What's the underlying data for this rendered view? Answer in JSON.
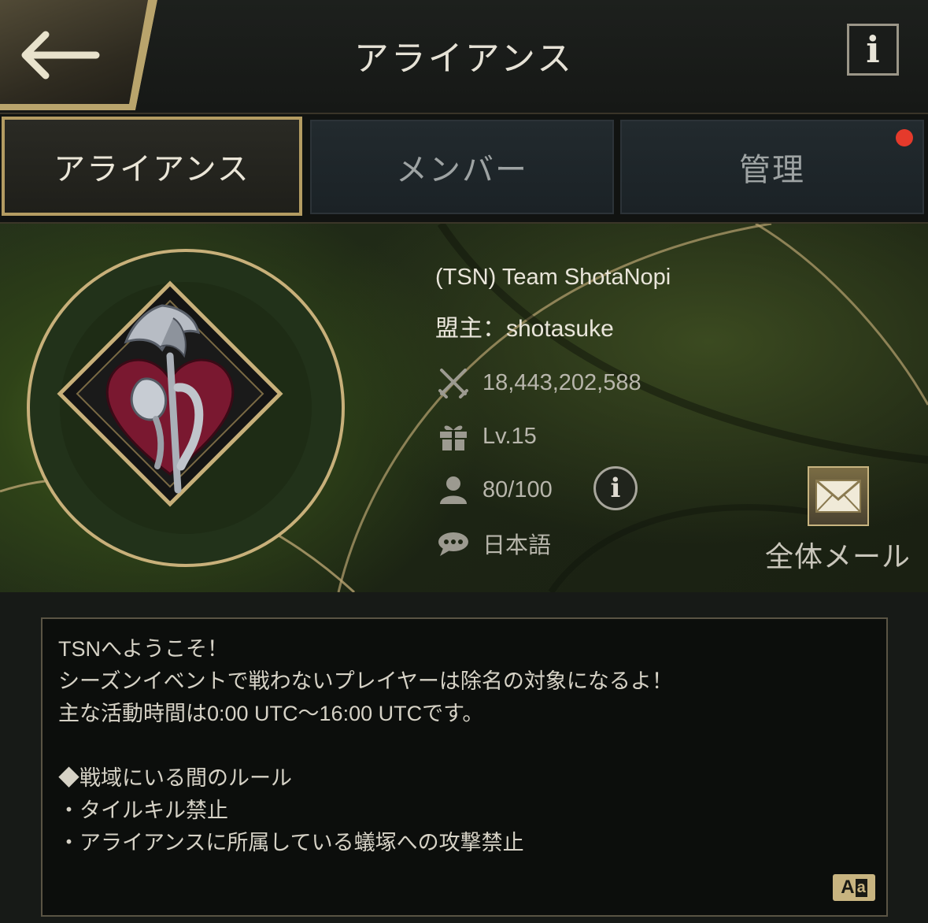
{
  "header": {
    "title": "アライアンス",
    "back_icon": "back-arrow-icon",
    "info_label": "i"
  },
  "tabs": [
    {
      "label": "アライアンス",
      "active": true
    },
    {
      "label": "メンバー",
      "active": false
    },
    {
      "label": "管理",
      "active": false,
      "notification": true
    }
  ],
  "alliance": {
    "name": "(TSN) Team ShotaNopi",
    "leader": "盟主：shotasuke",
    "power": "18,443,202,588",
    "level": "Lv.15",
    "members": "80/100",
    "language": "日本語",
    "member_info_label": "i",
    "mail_label": "全体メール"
  },
  "description": {
    "lines": [
      "TSNへようこそ！",
      "シーズンイベントで戦わないプレイヤーは除名の対象になるよ！",
      "主な活動時間は0:00 UTC〜16:00 UTCです。",
      "",
      "◆戦域にいる間のルール",
      "・タイルキル禁止",
      "・アライアンスに所属している蟻塚への攻撃禁止"
    ]
  },
  "translate": {
    "a": "A",
    "b": "a"
  },
  "colors": {
    "accent_gold": "#b49c62",
    "notification_red": "#e53a2b",
    "emblem_red": "#7a1830"
  }
}
